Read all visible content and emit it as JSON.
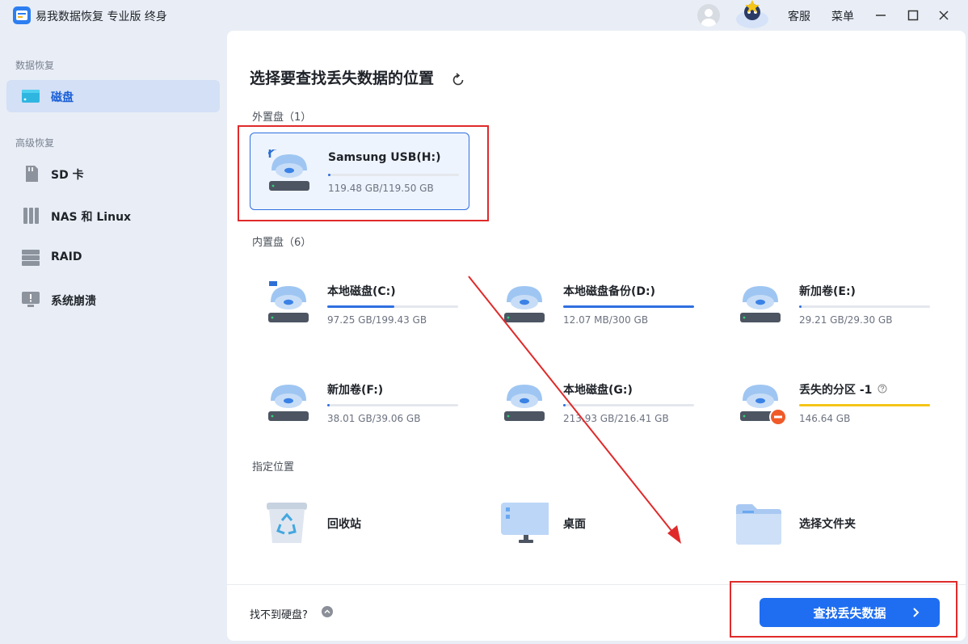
{
  "app": {
    "title": "易我数据恢复 专业版 终身"
  },
  "titlebar": {
    "support": "客服",
    "menu": "菜单"
  },
  "sidebar": {
    "section1": "数据恢复",
    "section2": "高级恢复",
    "items": [
      {
        "label": "磁盘",
        "icon": "disk-icon"
      },
      {
        "label": "SD 卡",
        "icon": "sd-card-icon"
      },
      {
        "label": "NAS 和 Linux",
        "icon": "nas-icon"
      },
      {
        "label": "RAID",
        "icon": "raid-icon"
      },
      {
        "label": "系统崩溃",
        "icon": "system-crash-icon"
      }
    ]
  },
  "main": {
    "title": "选择要查找丢失数据的位置",
    "external_label": "外置盘（1）",
    "internal_label": "内置盘（6）",
    "locations_label": "指定位置",
    "external": [
      {
        "name": "Samsung USB(H:)",
        "size": "119.48 GB/119.50 GB",
        "used": 0.02
      }
    ],
    "internal": [
      {
        "name": "本地磁盘(C:)",
        "size": "97.25 GB/199.43 GB",
        "used": 0.51
      },
      {
        "name": "本地磁盘备份(D:)",
        "size": "12.07 MB/300 GB",
        "used": 1.0
      },
      {
        "name": "新加卷(E:)",
        "size": "29.21 GB/29.30 GB",
        "used": 0.02
      },
      {
        "name": "新加卷(F:)",
        "size": "38.01 GB/39.06 GB",
        "used": 0.02
      },
      {
        "name": "本地磁盘(G:)",
        "size": "213.93 GB/216.41 GB",
        "used": 0.02
      },
      {
        "name": "丢失的分区 -1",
        "size": "146.64 GB",
        "used": 1.0
      }
    ],
    "locations": [
      {
        "name": "回收站"
      },
      {
        "name": "桌面"
      },
      {
        "name": "选择文件夹"
      }
    ],
    "help_text": "找不到硬盘?",
    "scan_button": "查找丢失数据"
  },
  "colors": {
    "accent": "#1f6ef1",
    "lost_bar": "#f5c518",
    "annotation": "#e02a2a"
  }
}
